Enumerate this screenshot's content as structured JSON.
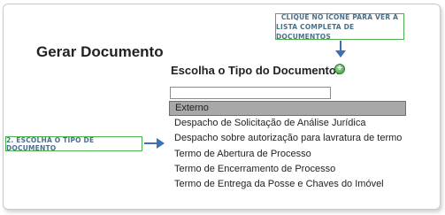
{
  "page": {
    "title": "Gerar Documento"
  },
  "callouts": {
    "top_line1": "Clique no ícone para ver a",
    "top_line2": "lista completa de documentos",
    "left": "2. Escolha o tipo de documento"
  },
  "form": {
    "section_label": "Escolha o Tipo do Documento:",
    "add_icon": "plus-circle-icon",
    "filter_value": "",
    "filter_placeholder": ""
  },
  "document_types": {
    "selected": "Externo",
    "items": [
      "Externo",
      "Despacho de Solicitação de Análise Jurídica",
      "Despacho sobre autorização para lavratura de termo",
      "Termo de Abertura de Processo",
      "Termo de Encerramento de Processo",
      "Termo de Entrega da Posse e Chaves do Imóvel"
    ]
  },
  "colors": {
    "callout_border": "#4caf50",
    "callout_text": "#4a6f8a",
    "arrow": "#3b6fb6",
    "selected_row": "#a8a8a8",
    "add_icon": "#3a9a3a"
  }
}
